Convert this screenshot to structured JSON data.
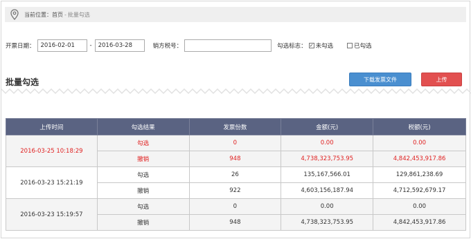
{
  "breadcrumb": {
    "label": "当前位置：",
    "home": "首页",
    "sep": "-",
    "current": "批量勾选"
  },
  "filters": {
    "date_label": "开票日期：",
    "date_from": "2016-02-01",
    "date_sep": "-",
    "date_to": "2016-03-28",
    "tax_label": "销方税号：",
    "tax_value": "",
    "flag_label": "勾选标志：",
    "opt_unchecked": "未勾选",
    "opt_checked": "已勾选",
    "opt_unchecked_state": true,
    "opt_checked_state": false
  },
  "section": {
    "title": "批量勾选"
  },
  "buttons": {
    "download": "下载发票文件",
    "upload": "上传"
  },
  "colors": {
    "header_bg": "#5a6382",
    "download": "#4a8fd0",
    "upload": "#e25050",
    "highlight": "#e02020"
  },
  "table": {
    "headers": [
      "上传时间",
      "勾选结果",
      "发票份数",
      "金额(元)",
      "税额(元)"
    ],
    "groups": [
      {
        "time": "2016-03-25 10:18:29",
        "highlight": true,
        "rows": [
          {
            "result": "勾选",
            "count": "0",
            "amount": "0.00",
            "tax": "0.00"
          },
          {
            "result": "撤销",
            "count": "948",
            "amount": "4,738,323,753.95",
            "tax": "4,842,453,917.86"
          }
        ]
      },
      {
        "time": "2016-03-23 15:21:19",
        "highlight": false,
        "rows": [
          {
            "result": "勾选",
            "count": "26",
            "amount": "135,167,566.01",
            "tax": "129,861,238.69"
          },
          {
            "result": "撤销",
            "count": "922",
            "amount": "4,603,156,187.94",
            "tax": "4,712,592,679.17"
          }
        ]
      },
      {
        "time": "2016-03-23 15:19:57",
        "highlight": false,
        "rows": [
          {
            "result": "勾选",
            "count": "0",
            "amount": "0.00",
            "tax": "0.00"
          },
          {
            "result": "撤销",
            "count": "948",
            "amount": "4,738,323,753.95",
            "tax": "4,842,453,917.86"
          }
        ]
      }
    ]
  }
}
